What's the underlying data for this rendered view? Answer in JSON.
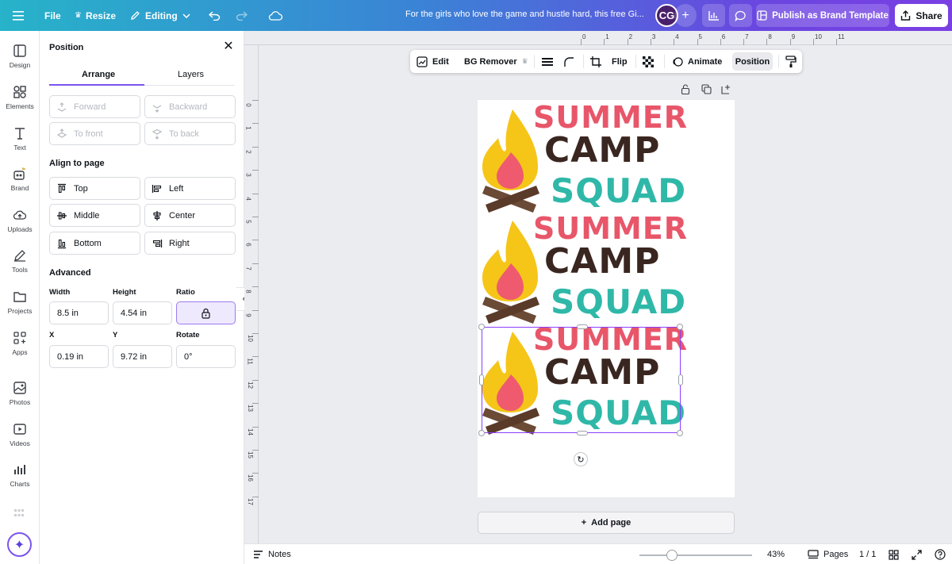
{
  "topbar": {
    "file": "File",
    "resize": "Resize",
    "editing": "Editing",
    "title": "For the girls who love the game and hustle hard, this free Gi...",
    "avatar_initials": "CG",
    "publish": "Publish as Brand Template",
    "share": "Share"
  },
  "rail": [
    {
      "label": "Design",
      "icon": "layout-icon"
    },
    {
      "label": "Elements",
      "icon": "shapes-icon"
    },
    {
      "label": "Text",
      "icon": "text-icon"
    },
    {
      "label": "Brand",
      "icon": "brand-icon"
    },
    {
      "label": "Uploads",
      "icon": "cloud-upload-icon"
    },
    {
      "label": "Tools",
      "icon": "pen-icon"
    },
    {
      "label": "Projects",
      "icon": "folder-icon"
    },
    {
      "label": "Apps",
      "icon": "apps-icon"
    },
    {
      "label": "Photos",
      "icon": "image-icon"
    },
    {
      "label": "Videos",
      "icon": "video-icon"
    },
    {
      "label": "Charts",
      "icon": "chart-icon"
    }
  ],
  "panel": {
    "title": "Position",
    "tabs": [
      "Arrange",
      "Layers"
    ],
    "arrange": {
      "forward": "Forward",
      "backward": "Backward",
      "to_front": "To front",
      "to_back": "To back"
    },
    "align_title": "Align to page",
    "align": {
      "top": "Top",
      "left": "Left",
      "middle": "Middle",
      "center": "Center",
      "bottom": "Bottom",
      "right": "Right"
    },
    "advanced_title": "Advanced",
    "labels": {
      "width": "Width",
      "height": "Height",
      "ratio": "Ratio",
      "x": "X",
      "y": "Y",
      "rotate": "Rotate"
    },
    "values": {
      "width": "8.5 in",
      "height": "4.54 in",
      "x": "0.19 in",
      "y": "9.72 in",
      "rotate": "0°"
    }
  },
  "ruler": {
    "top": [
      "0",
      "1",
      "2",
      "3",
      "4",
      "5",
      "6",
      "7",
      "8",
      "9",
      "10",
      "11"
    ],
    "left": [
      "0",
      "1",
      "2",
      "3",
      "4",
      "5",
      "6",
      "7",
      "8",
      "9",
      "10",
      "11",
      "12",
      "13",
      "14",
      "15",
      "16",
      "17"
    ]
  },
  "toolbar": {
    "edit": "Edit",
    "bg_remover": "BG Remover",
    "flip": "Flip",
    "animate": "Animate",
    "position": "Position"
  },
  "design": {
    "line1": "SUMMER",
    "line2": "CAMP",
    "line3": "SQUAD",
    "colors": {
      "summer": "#e8566a",
      "camp": "#3a2620",
      "squad": "#2fb8a8",
      "flame": "#f5c518",
      "inner_flame": "#ef5a6f",
      "logs": "#6b4a36"
    }
  },
  "add_page": "Add page",
  "bottombar": {
    "notes": "Notes",
    "zoom": "43%",
    "pages": "Pages",
    "page_count": "1 / 1"
  },
  "accent": "#8b3dff"
}
